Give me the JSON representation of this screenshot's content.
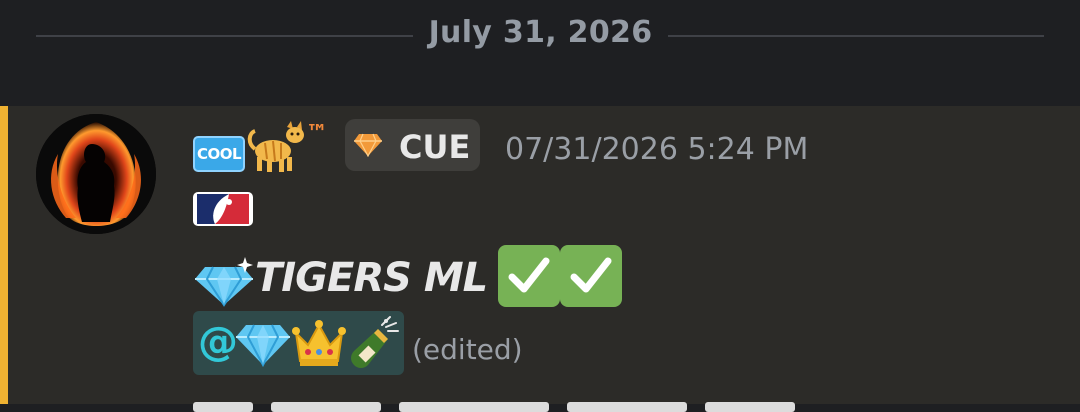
{
  "date_divider": {
    "text": "July 31, 2026"
  },
  "message": {
    "author_badges": {
      "cool": "COOL",
      "tm": "™"
    },
    "role_tag": {
      "name": "CUE",
      "icon": "orange-diamond-icon"
    },
    "timestamp": "07/31/2026 5:24 PM",
    "league_badge": "mlb-logo-icon",
    "pick_text": "TIGERS ML",
    "mention": {
      "at": "@"
    },
    "edited_label": "(edited)"
  },
  "colors": {
    "background": "#1e1f22",
    "message_bg": "#2c2b28",
    "mention_bar": "#f0b232",
    "check_green": "#77b255"
  }
}
